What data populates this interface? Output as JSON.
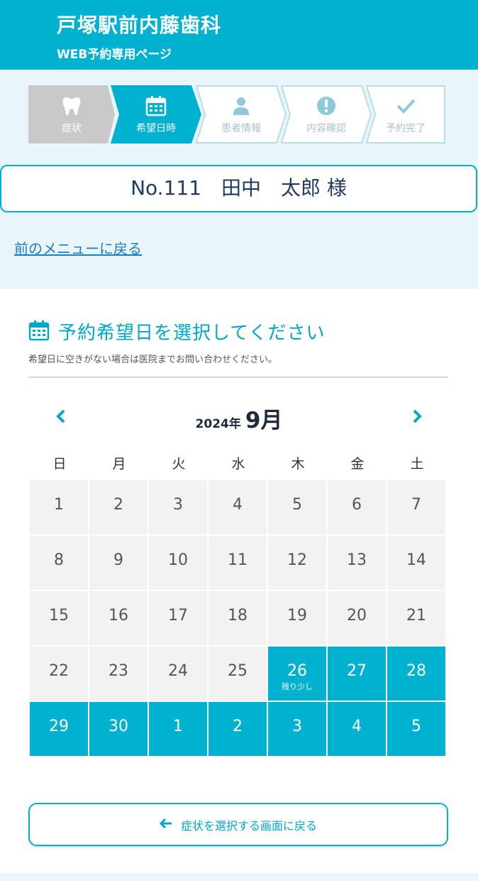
{
  "header": {
    "title": "戸塚駅前内藤歯科",
    "subtitle": "WEB予約専用ページ"
  },
  "steps": [
    {
      "label": "症状",
      "icon": "tooth-icon",
      "state": "done"
    },
    {
      "label": "希望日時",
      "icon": "calendar-icon",
      "state": "active"
    },
    {
      "label": "患者情報",
      "icon": "person-icon",
      "state": "future"
    },
    {
      "label": "内容確認",
      "icon": "exclamation-icon",
      "state": "future"
    },
    {
      "label": "予約完了",
      "icon": "check-icon",
      "state": "future"
    }
  ],
  "patient": {
    "name": "No.111　田中　太郎 様"
  },
  "back_link": "前のメニューに戻る",
  "section": {
    "title": "予約希望日を選択してください",
    "note": "希望日に空きがない場合は医院までお問い合わせください。"
  },
  "calendar": {
    "year_label": "2024年",
    "month_label": "9月",
    "weekdays": [
      "日",
      "月",
      "火",
      "水",
      "木",
      "金",
      "土"
    ],
    "weeks": [
      [
        {
          "d": "1"
        },
        {
          "d": "2"
        },
        {
          "d": "3"
        },
        {
          "d": "4"
        },
        {
          "d": "5"
        },
        {
          "d": "6"
        },
        {
          "d": "7"
        }
      ],
      [
        {
          "d": "8"
        },
        {
          "d": "9"
        },
        {
          "d": "10"
        },
        {
          "d": "11"
        },
        {
          "d": "12"
        },
        {
          "d": "13"
        },
        {
          "d": "14"
        }
      ],
      [
        {
          "d": "15"
        },
        {
          "d": "16"
        },
        {
          "d": "17"
        },
        {
          "d": "18"
        },
        {
          "d": "19"
        },
        {
          "d": "20"
        },
        {
          "d": "21"
        }
      ],
      [
        {
          "d": "22"
        },
        {
          "d": "23"
        },
        {
          "d": "24"
        },
        {
          "d": "25"
        },
        {
          "d": "26",
          "avail": true,
          "note": "残り少し"
        },
        {
          "d": "27",
          "avail": true
        },
        {
          "d": "28",
          "avail": true
        }
      ],
      [
        {
          "d": "29",
          "avail": true
        },
        {
          "d": "30",
          "avail": true
        },
        {
          "d": "1",
          "avail": true
        },
        {
          "d": "2",
          "avail": true
        },
        {
          "d": "3",
          "avail": true
        },
        {
          "d": "4",
          "avail": true
        },
        {
          "d": "5",
          "avail": true
        }
      ]
    ]
  },
  "back_button": "症状を選択する画面に戻る",
  "colors": {
    "accent": "#00b2d0",
    "done_step": "#c8c8c8",
    "future_step_border": "#b9dde7"
  }
}
